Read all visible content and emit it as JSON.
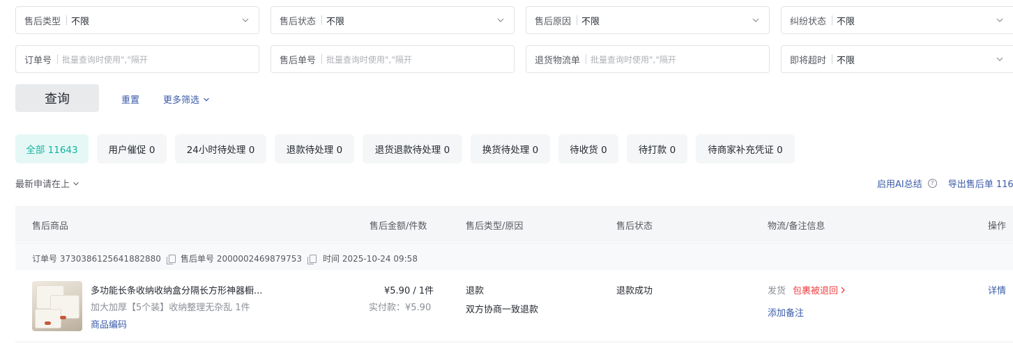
{
  "filters": {
    "after_sale_type": {
      "label": "售后类型",
      "value": "不限"
    },
    "after_sale_status": {
      "label": "售后状态",
      "value": "不限"
    },
    "after_sale_reason": {
      "label": "售后原因",
      "value": "不限"
    },
    "dispute_status": {
      "label": "纠纷状态",
      "value": "不限"
    },
    "order_no": {
      "label": "订单号",
      "placeholder": "批量查询时使用\",\"隔开"
    },
    "after_sale_no": {
      "label": "售后单号",
      "placeholder": "批量查询时使用\",\"隔开"
    },
    "return_logistics_no": {
      "label": "退货物流单",
      "placeholder": "批量查询时使用\",\"隔开"
    },
    "about_to_timeout": {
      "label": "即将超时",
      "value": "不限"
    }
  },
  "actions": {
    "query": "查询",
    "reset": "重置",
    "more_filters": "更多筛选"
  },
  "tabs": [
    {
      "label": "全部 11643",
      "active": true
    },
    {
      "label": "用户催促 0"
    },
    {
      "label": "24小时待处理 0"
    },
    {
      "label": "退款待处理 0"
    },
    {
      "label": "退货退款待处理 0"
    },
    {
      "label": "换货待处理 0"
    },
    {
      "label": "待收货 0"
    },
    {
      "label": "待打款 0"
    },
    {
      "label": "待商家补充凭证 0"
    }
  ],
  "sort": {
    "label": "最新申请在上"
  },
  "top_right": {
    "ai_summary": "启用AI总结",
    "export": "导出售后单 116"
  },
  "table": {
    "columns": [
      "售后商品",
      "售后金额/件数",
      "售后类型/原因",
      "售后状态",
      "物流/备注信息",
      "操作"
    ],
    "rows": [
      {
        "order_info": {
          "order_no": "订单号 3730386125641882880",
          "after_sale_no": "售后单号 2000002469879753",
          "time": "时间 2025-10-24 09:58"
        },
        "product_title": "多功能长条收纳收纳盒分隔长方形神器橱...",
        "product_spec": "加大加厚【5个装】收纳整理无杂乱 1件",
        "product_code_link": "商品编码",
        "amount": "¥5.90 / 1件",
        "paid": "实付款：¥5.90",
        "type": "退款",
        "reason": "双方协商一致退款",
        "status": "退款成功",
        "logistics_label": "发货",
        "logistics_status": "包裹被退回",
        "add_note": "添加备注",
        "action": "详情"
      }
    ]
  },
  "colors": {
    "accent_teal": "#12b3a0",
    "link_blue": "#3a5ba8",
    "alert_red": "#f04142"
  }
}
